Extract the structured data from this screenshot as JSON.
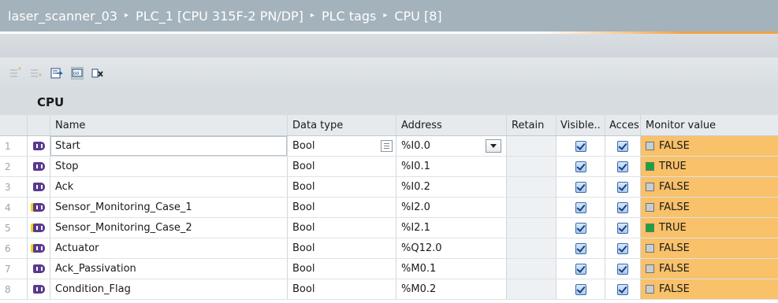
{
  "breadcrumb": {
    "items": [
      "laser_scanner_03",
      "PLC_1 [CPU 315F-2 PN/DP]",
      "PLC tags",
      "CPU [8]"
    ],
    "separator": "▸"
  },
  "toolbar": {
    "buttons": [
      {
        "icon": "insert-row-icon",
        "enabled": false
      },
      {
        "icon": "add-row-icon",
        "enabled": false
      },
      {
        "icon": "export-icon",
        "enabled": true
      },
      {
        "icon": "monitor-all-icon",
        "enabled": true,
        "pressed": true
      },
      {
        "icon": "delete-tag-icon",
        "enabled": true
      }
    ]
  },
  "section_title": "CPU",
  "table": {
    "headers": {
      "num": "",
      "icon": "",
      "name": "Name",
      "type": "Data type",
      "address": "Address",
      "retain": "Retain",
      "visible": "Visible..",
      "access": "Acces...",
      "monitor": "Monitor value"
    },
    "rows": [
      {
        "num": "1",
        "name": "Start",
        "type": "Bool",
        "address": "%I0.0",
        "visible": true,
        "access": true,
        "monitor": "FALSE",
        "state": false,
        "selected": true
      },
      {
        "num": "2",
        "name": "Stop",
        "type": "Bool",
        "address": "%I0.1",
        "visible": true,
        "access": true,
        "monitor": "TRUE",
        "state": true
      },
      {
        "num": "3",
        "name": "Ack",
        "type": "Bool",
        "address": "%I0.2",
        "visible": true,
        "access": true,
        "monitor": "FALSE",
        "state": false
      },
      {
        "num": "4",
        "name": "Sensor_Monitoring_Case_1",
        "type": "Bool",
        "address": "%I2.0",
        "visible": true,
        "access": true,
        "monitor": "FALSE",
        "state": false,
        "failsafe": true
      },
      {
        "num": "5",
        "name": "Sensor_Monitoring_Case_2",
        "type": "Bool",
        "address": "%I2.1",
        "visible": true,
        "access": true,
        "monitor": "TRUE",
        "state": true,
        "failsafe": true
      },
      {
        "num": "6",
        "name": "Actuator",
        "type": "Bool",
        "address": "%Q12.0",
        "visible": true,
        "access": true,
        "monitor": "FALSE",
        "state": false,
        "failsafe": true
      },
      {
        "num": "7",
        "name": "Ack_Passivation",
        "type": "Bool",
        "address": "%M0.1",
        "visible": true,
        "access": true,
        "monitor": "FALSE",
        "state": false
      },
      {
        "num": "8",
        "name": "Condition_Flag",
        "type": "Bool",
        "address": "%M0.2",
        "visible": true,
        "access": true,
        "monitor": "FALSE",
        "state": false
      }
    ]
  },
  "colors": {
    "title_bar": "#a3b2bb",
    "accent": "#f2a345",
    "monitor_bg": "#f8c16a",
    "true_indicator": "#19a53a",
    "false_indicator": "#c8cdd1",
    "tag_icon": "#5a3a8e",
    "failsafe_marker": "#f2d21b"
  }
}
